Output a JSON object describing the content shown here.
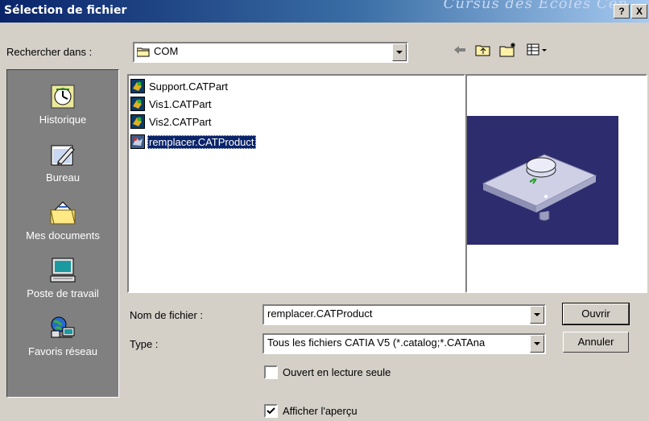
{
  "window": {
    "title": "Sélection de fichier",
    "watermark": "Cursus des Ecoles Cen",
    "help_label": "?",
    "close_label": "X"
  },
  "lookin": {
    "label": "Rechercher dans :",
    "value": "COM"
  },
  "places": [
    {
      "label": "Historique",
      "icon": "history-icon"
    },
    {
      "label": "Bureau",
      "icon": "desktop-icon"
    },
    {
      "label": "Mes documents",
      "icon": "my-documents-icon"
    },
    {
      "label": "Poste de travail",
      "icon": "my-computer-icon"
    },
    {
      "label": "Favoris réseau",
      "icon": "network-places-icon"
    }
  ],
  "files": [
    {
      "name": "Support.CATPart",
      "icon": "catpart-icon",
      "selected": false
    },
    {
      "name": "Vis1.CATPart",
      "icon": "catpart-icon",
      "selected": false
    },
    {
      "name": "Vis2.CATPart",
      "icon": "catpart-icon",
      "selected": false
    },
    {
      "name": "remplacer.CATProduct",
      "icon": "catproduct-icon",
      "selected": true
    }
  ],
  "filename": {
    "label": "Nom de fichier :",
    "value": "remplacer.CATProduct"
  },
  "filetype": {
    "label": "Type :",
    "value": "Tous les fichiers CATIA V5 (*.catalog;*.CATAna"
  },
  "readonly": {
    "label": "Ouvert en lecture seule",
    "checked": false
  },
  "show_preview": {
    "label": "Afficher l'aperçu",
    "checked": true
  },
  "buttons": {
    "open": "Ouvrir",
    "cancel": "Annuler"
  },
  "colors": {
    "titlebar": "#0a246a",
    "selection": "#0a246a",
    "preview_background": "#2c2c6e",
    "face": "#d4d0c8"
  }
}
